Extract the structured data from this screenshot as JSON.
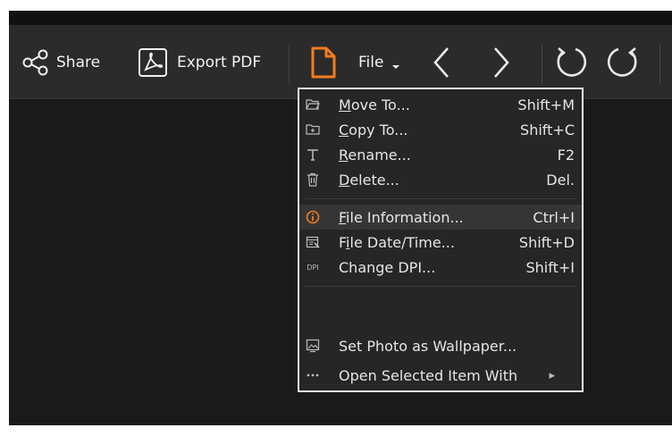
{
  "toolbar": {
    "share_label": "Share",
    "export_label": "Export PDF",
    "file_label": "File",
    "icons": [
      "share-icon",
      "export-pdf-icon",
      "file-icon",
      "chevron-down-icon",
      "back-arrow-icon",
      "forward-arrow-icon",
      "rotate-left-icon",
      "rotate-right-icon"
    ]
  },
  "menu": {
    "items": [
      {
        "icon": "folder-open-icon",
        "prefix": "",
        "accel": "M",
        "rest": "ove To...",
        "shortcut": "Shift+M"
      },
      {
        "icon": "copy-folder-icon",
        "prefix": "",
        "accel": "C",
        "rest": "opy To...",
        "shortcut": "Shift+C"
      },
      {
        "icon": "rename-text-icon",
        "prefix": "",
        "accel": "R",
        "rest": "ename...",
        "shortcut": "F2"
      },
      {
        "icon": "trash-icon",
        "prefix": "",
        "accel": "D",
        "rest": "elete...",
        "shortcut": "Del."
      },
      {
        "icon": "info-icon",
        "prefix": "",
        "accel": "F",
        "rest": "ile Information...",
        "shortcut": "Ctrl+I"
      },
      {
        "icon": "date-time-icon",
        "prefix": "F",
        "accel": "i",
        "rest": "le Date/Time...",
        "shortcut": "Shift+D"
      },
      {
        "icon": "dpi-icon",
        "icon_text": "DPI",
        "prefix": "Change DPI...",
        "accel": "",
        "rest": "",
        "shortcut": "Shift+I"
      },
      {
        "icon": "wallpaper-icon",
        "prefix": "Set Photo as Wallpaper...",
        "accel": "",
        "rest": "",
        "shortcut": ""
      },
      {
        "icon": "more-dots-icon",
        "prefix": "Open Selected Item With",
        "accel": "",
        "rest": "",
        "shortcut": ""
      }
    ],
    "submenu_arrow": "▸"
  },
  "colors": {
    "accent_orange": "#f57c1f",
    "toolbar_bg": "#2b2b2b",
    "menu_bg": "#262626",
    "menu_border": "#e6e6e6",
    "content_bg": "#1a1a1a"
  }
}
